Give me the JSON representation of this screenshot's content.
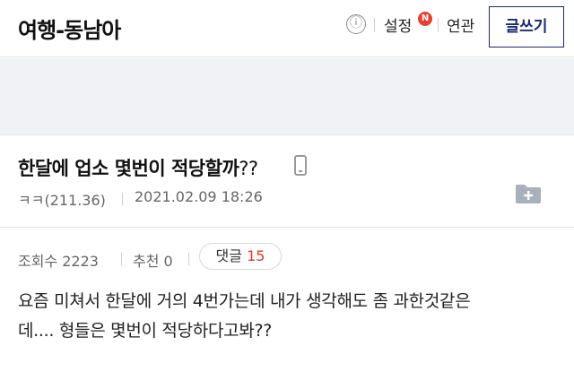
{
  "header": {
    "board_title": "여행-동남아",
    "info_icon": "ⓘ",
    "settings_label": "설정",
    "new_badge": "N",
    "related_label": "연관",
    "write_button_label": "글쓰기"
  },
  "post": {
    "title": "한달에 업소 몇번이 적당할까",
    "title_suffix": "??",
    "author": "ㅋㅋ(211.36)",
    "date": "2021.02.09 18:26",
    "views_label": "조회수 2223",
    "recommend_label": "추천 0",
    "comments_label": "댓글",
    "comments_count": "15",
    "body_line1": "요즘 미쳐서 한달에 거의 4번가는데 내가 생각해도 좀 과한것같은",
    "body_line2": "데.... 형들은 몇번이 적당하다고봐??"
  },
  "icons": {
    "info": "info-icon",
    "mobile": "mobile-icon",
    "folder_add": "folder-add-icon"
  },
  "colors": {
    "write_button_border": "#1a2a6c",
    "new_badge": "#e8402e",
    "comments_count": "#e0392b",
    "band_background": "#f0f2f6"
  }
}
